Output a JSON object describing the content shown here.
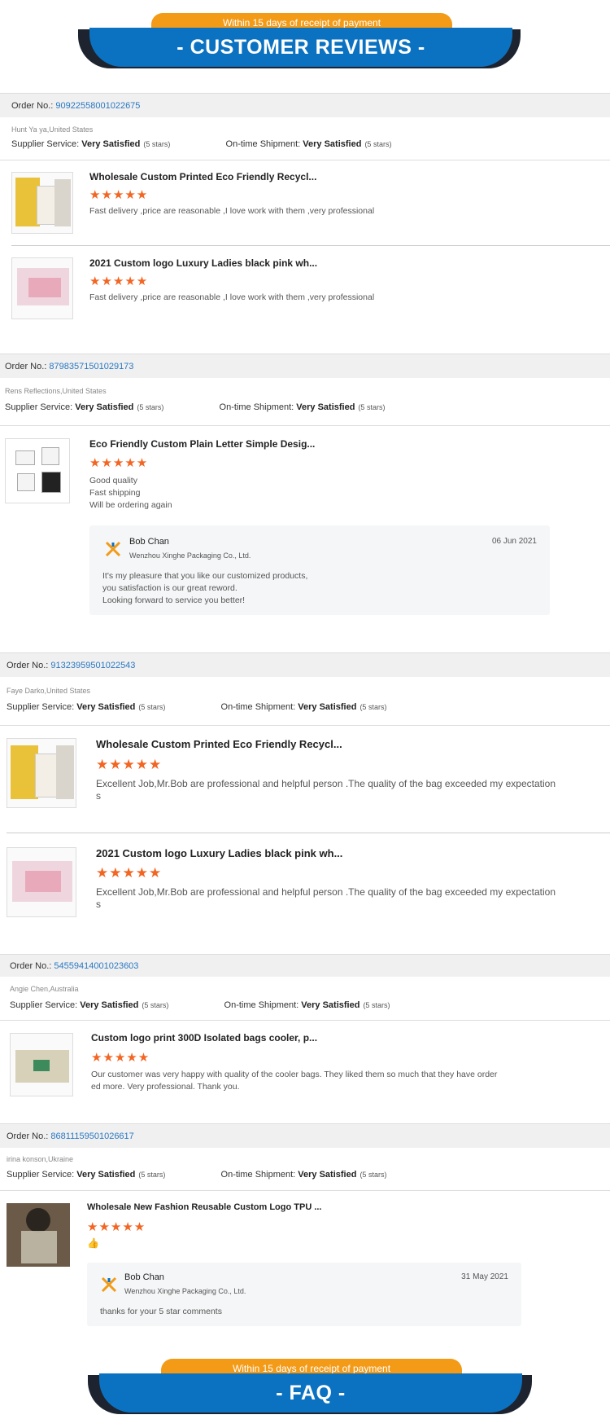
{
  "header_banner": {
    "pill": "Within 15 days of receipt of payment",
    "title": "- CUSTOMER REVIEWS -"
  },
  "footer_banner": {
    "pill": "Within 15 days of receipt of payment",
    "title": "- FAQ -"
  },
  "labels": {
    "order_no": "Order No.:",
    "supplier_service": "Supplier Service:",
    "on_time_shipment": "On-time Shipment:",
    "very_satisfied": "Very Satisfied",
    "five_stars": "(5 stars)",
    "stars": "★★★★★"
  },
  "reviews": [
    {
      "order_no": "90922558001022675",
      "reviewer": "Hunt Ya ya,United States",
      "items": [
        {
          "title": "Wholesale Custom Printed Eco Friendly Recycl...",
          "text": "Fast delivery ,price are reasonable ,I love work with them ,very professional"
        },
        {
          "title": "2021 Custom logo Luxury Ladies black pink wh...",
          "text": "Fast delivery ,price are reasonable ,I love work with them ,very professional"
        }
      ]
    },
    {
      "order_no": "87983571501029173",
      "reviewer": "Rens Reflections,United States",
      "items": [
        {
          "title": "Eco Friendly Custom Plain Letter Simple Desig...",
          "text_lines": [
            "Good quality",
            "Fast shipping",
            "Will be ordering again"
          ]
        }
      ],
      "reply": {
        "name": "Bob Chan",
        "company": "Wenzhou Xinghe Packaging Co., Ltd.",
        "date": "06 Jun 2021",
        "lines": [
          "It's my pleasure that you like our customized products,",
          "you satisfaction is our great reword.",
          "Looking forward to service  you better!"
        ]
      }
    },
    {
      "order_no": "91323959501022543",
      "reviewer": "Faye Darko,United States",
      "items": [
        {
          "title": "Wholesale Custom Printed Eco Friendly Recycl...",
          "text_lines": [
            "Excellent Job,Mr.Bob are professional and helpful person .The quality of the bag exceeded my expectation",
            "s"
          ]
        },
        {
          "title": "2021 Custom logo Luxury Ladies black pink wh...",
          "text_lines": [
            "Excellent Job,Mr.Bob are professional and helpful person .The quality of the bag exceeded my expectation",
            "s"
          ]
        }
      ]
    },
    {
      "order_no": "54559414001023603",
      "reviewer": "Angie Chen,Australia",
      "items": [
        {
          "title": "Custom logo print 300D Isolated bags cooler, p...",
          "text_lines": [
            "Our customer was very happy with quality of the cooler bags. They liked them so much that they have order",
            "ed more. Very professional. Thank you."
          ]
        }
      ]
    },
    {
      "order_no": "86811159501026617",
      "reviewer": "irina konson,Ukraine",
      "items": [
        {
          "title": "Wholesale New Fashion Reusable Custom Logo TPU ...",
          "text": "👍"
        }
      ],
      "reply": {
        "name": "Bob Chan",
        "company": "Wenzhou Xinghe Packaging Co., Ltd.",
        "date": "31 May 2021",
        "lines": [
          "thanks for your 5 star comments"
        ]
      }
    }
  ],
  "colors": {
    "orange": "#f39a17",
    "blue": "#0b72c1",
    "star": "#f26522",
    "link": "#2a78c2"
  }
}
